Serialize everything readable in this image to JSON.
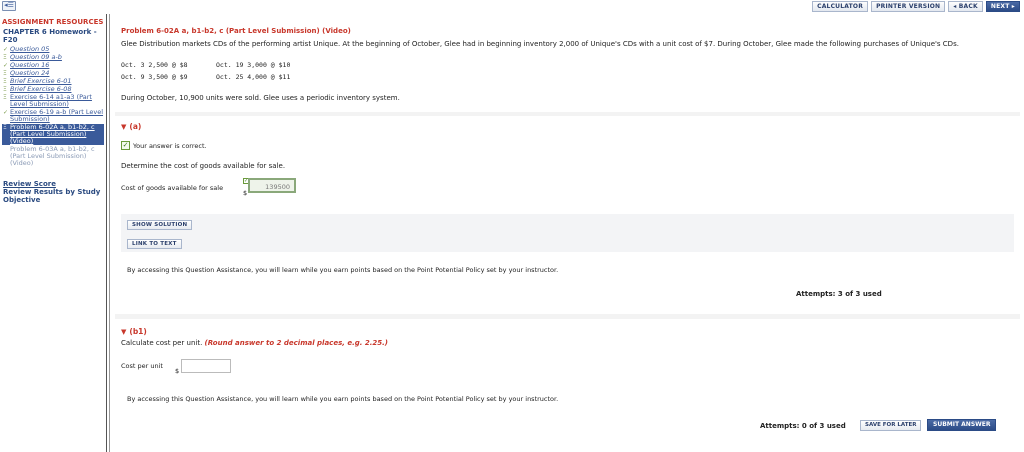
{
  "topbar": {
    "toggle_icon": "collapse-toggle-icon",
    "buttons": {
      "calculator": "CALCULATOR",
      "printer": "PRINTER VERSION",
      "back": "◂ BACK",
      "next": "NEXT ▸"
    }
  },
  "sidebar": {
    "title": "ASSIGNMENT RESOURCES",
    "chapter": "CHAPTER 6 Homework - F20",
    "items": [
      {
        "mark": "✓",
        "label": "Question 05"
      },
      {
        "mark": "Ξ",
        "label": "Question 09 a-b"
      },
      {
        "mark": "✓",
        "label": "Question 16"
      },
      {
        "mark": "Ξ",
        "label": "Question 24"
      },
      {
        "mark": "Ξ",
        "label": "Brief Exercise 6-01"
      },
      {
        "mark": "Ξ",
        "label": "Brief Exercise 6-08"
      },
      {
        "mark": "Ξ",
        "label": "Exercise 6-14 a1-a3 (Part Level Submission)"
      },
      {
        "mark": "✓",
        "label": "Exercise 6-19 a-b (Part Level Submission)"
      },
      {
        "mark": "Ξ",
        "label": "Problem 6-02A a, b1-b2, c (Part Level Submission) (Video)"
      },
      {
        "mark": "",
        "label": "Problem 6-03A a, b1-b2, c (Part Level Submission) (Video)"
      }
    ],
    "review_score": "Review Score",
    "review_results": "Review Results by Study Objective"
  },
  "problem": {
    "title": "Problem 6-02A a, b1-b2, c (Part Level Submission) (Video)",
    "intro": "Glee Distribution markets CDs of the performing artist Unique. At the beginning of October, Glee had in beginning inventory 2,000 of Unique's CDs with a unit cost of $7. During October, Glee made the following purchases of Unique's CDs.",
    "purchases": [
      {
        "left": "Oct. 3   2,500  @  $8",
        "right": "Oct. 19   3,000  @  $10"
      },
      {
        "left": "Oct. 9   3,500  @  $9",
        "right": "Oct. 25   4,000  @  $11"
      }
    ],
    "sold": "During October, 10,900 units were sold. Glee uses a periodic inventory system."
  },
  "part_a": {
    "heading": "(a)",
    "correct_text": "Your answer is correct.",
    "prompt": "Determine the cost of goods available for sale.",
    "input_label": "Cost of goods available for sale",
    "currency": "$",
    "value": "139500",
    "show_solution": "SHOW SOLUTION",
    "link_to_text": "LINK TO TEXT",
    "policy": "By accessing this Question Assistance, you will learn while you earn points based on the Point Potential Policy set by your instructor.",
    "attempts": "Attempts: 3 of 3 used"
  },
  "part_b1": {
    "heading": "(b1)",
    "prompt_plain": "Calculate cost per unit.",
    "prompt_note": "(Round answer to 2 decimal places, e.g. 2.25.)",
    "input_label": "Cost per unit",
    "currency": "$",
    "value": "",
    "policy": "By accessing this Question Assistance, you will learn while you earn points based on the Point Potential Policy set by your instructor.",
    "attempts": "Attempts: 0 of 3 used",
    "save_later": "SAVE FOR LATER",
    "submit": "SUBMIT ANSWER"
  }
}
